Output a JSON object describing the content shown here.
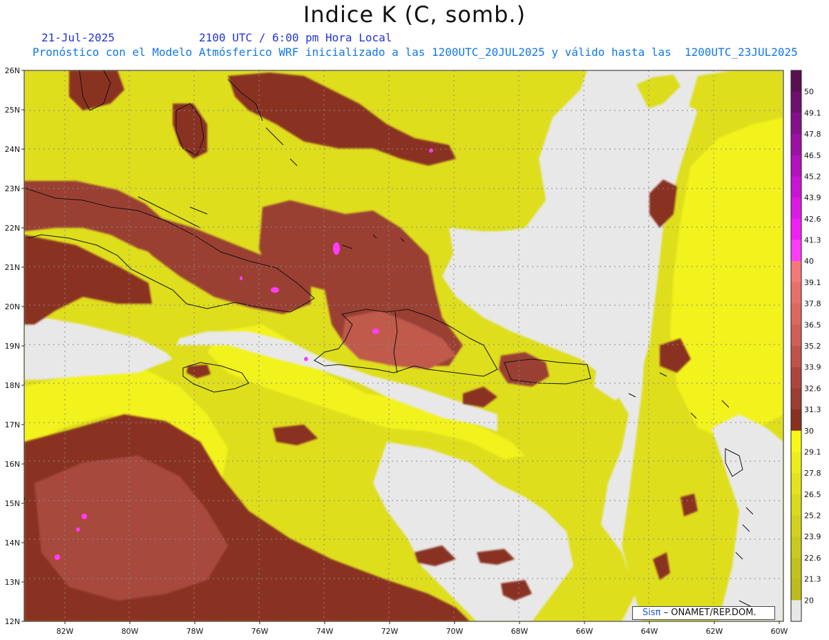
{
  "header": {
    "title": "Indice K (C, somb.)",
    "date": "21-Jul-2025",
    "time": "2100 UTC / 6:00 pm Hora Local",
    "forecast_line": "Pronóstico con el Modelo Atmósferico WRF inicializado a las 1200UTC_20JUL2025 y válido hasta las  1200UTC_23JUL2025"
  },
  "axes": {
    "lon_labels": [
      "82W",
      "80W",
      "78W",
      "76W",
      "74W",
      "72W",
      "70W",
      "68W",
      "66W",
      "64W",
      "62W",
      "60W"
    ],
    "lat_labels": [
      "26N",
      "25N",
      "24N",
      "23N",
      "22N",
      "21N",
      "20N",
      "19N",
      "18N",
      "17N",
      "16N",
      "15N",
      "14N",
      "13N",
      "12N"
    ]
  },
  "colorbar": {
    "labels": [
      "50",
      "49.1",
      "47.8",
      "46.5",
      "45.2",
      "43.9",
      "42.6",
      "41.3",
      "40",
      "39.1",
      "37.8",
      "36.5",
      "35.2",
      "33.9",
      "32.6",
      "31.3",
      "30",
      "29.1",
      "27.8",
      "26.5",
      "25.2",
      "23.9",
      "22.6",
      "21.3",
      "20"
    ],
    "colors": [
      "#5a1050",
      "#6e1070",
      "#86108c",
      "#9c10a6",
      "#b212c0",
      "#c814d4",
      "#dc18e4",
      "#f020f4",
      "#ff3cfc",
      "#f47a78",
      "#e8706a",
      "#dc6860",
      "#d05e56",
      "#c0524a",
      "#ae4640",
      "#9c3c32",
      "#8a3020",
      "#f8f818",
      "#eeee1c",
      "#e4e41e",
      "#dada1e",
      "#d2d21e",
      "#caca1e",
      "#c2c21e",
      "#bcbc1e",
      "#e8e8e8"
    ],
    "colors_note": ""
  },
  "palette": {
    "background": "#e8e8e8",
    "yellow_bright": "#f0f01c",
    "yellow_mid": "#d8d81e",
    "yellow_dark": "#c8c81e",
    "brown": "#9a4030",
    "brown_dark": "#8a3020",
    "salmon": "#c86456",
    "magenta": "#ff3cfc",
    "coast": "#111111"
  },
  "credit": {
    "brand": "Sisπ",
    "text": " – ONAMET/REP.DOM."
  }
}
